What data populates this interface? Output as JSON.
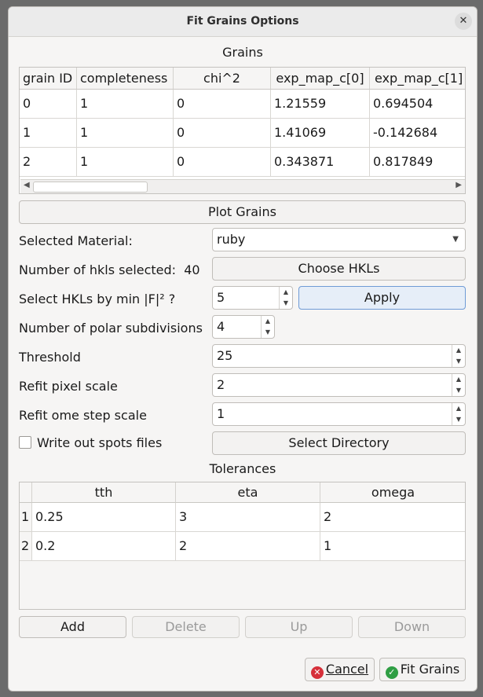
{
  "window": {
    "title": "Fit Grains Options"
  },
  "grains": {
    "title": "Grains",
    "columns": [
      "grain ID",
      "completeness",
      "chi^2",
      "exp_map_c[0]",
      "exp_map_c[1]"
    ],
    "rows": [
      [
        "0",
        "1",
        "0",
        "1.21559",
        "0.694504"
      ],
      [
        "1",
        "1",
        "0",
        "1.41069",
        "-0.142684"
      ],
      [
        "2",
        "1",
        "0",
        "0.343871",
        "0.817849"
      ]
    ]
  },
  "buttons": {
    "plot_grains": "Plot Grains",
    "choose_hkls": "Choose HKLs",
    "apply": "Apply",
    "select_directory": "Select Directory",
    "add": "Add",
    "delete": "Delete",
    "up": "Up",
    "down": "Down",
    "cancel": "Cancel",
    "fit_grains": "Fit Grains"
  },
  "form": {
    "selected_material_label": "Selected Material:",
    "selected_material_value": "ruby",
    "num_hkls_label": "Number of hkls selected:",
    "num_hkls_value": "40",
    "select_hkls_label": "Select HKLs by min |F|² ?",
    "select_hkls_value": "5",
    "polar_label": "Number of polar subdivisions",
    "polar_value": "4",
    "threshold_label": "Threshold",
    "threshold_value": "25",
    "refit_pixel_label": "Refit pixel scale",
    "refit_pixel_value": "2",
    "refit_ome_label": "Refit ome step scale",
    "refit_ome_value": "1",
    "write_spots_label": "Write out spots files"
  },
  "tolerances": {
    "title": "Tolerances",
    "columns": [
      "tth",
      "eta",
      "omega"
    ],
    "rows": [
      {
        "index": "1",
        "values": [
          "0.25",
          "3",
          "2"
        ]
      },
      {
        "index": "2",
        "values": [
          "0.2",
          "2",
          "1"
        ]
      }
    ]
  }
}
